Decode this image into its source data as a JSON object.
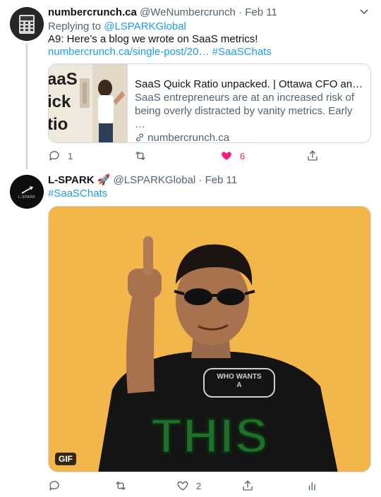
{
  "tweet1": {
    "author_name": "numbercrunch.ca",
    "handle": "@WeNumbercrunch",
    "separator": "·",
    "date": "Feb 11",
    "replying_prefix": "Replying to",
    "replying_to": "@LSPARKGlobal",
    "text_main": "A9:  Here’s a blog we wrote on SaaS metrics! ",
    "text_link": "numbercrunch.ca/single-post/20…",
    "text_hashtag": "#SaaSChats",
    "card": {
      "image_text_1": "aaS",
      "image_text_2": "ick",
      "image_text_3": "tio",
      "title": "SaaS Quick Ratio unpacked. | Ottawa CFO and Bo…",
      "description": "SaaS entrepreneurs are at an increased risk of being overly distracted by vanity metrics.  Early …",
      "domain": "numbercrunch.ca"
    },
    "actions": {
      "reply_count": "1",
      "retweet_count": "",
      "like_count": "6",
      "liked": true
    }
  },
  "tweet2": {
    "author_name": "L-SPARK",
    "author_emoji": "🚀",
    "handle": "@LSPARKGlobal",
    "separator": "·",
    "date": "Feb 11",
    "text_hashtag": "#SaaSChats",
    "gif": {
      "caption": "THIS",
      "shirt_text_1": "WHO",
      "shirt_text_2": "WANTS",
      "shirt_text_3": "A",
      "badge": "GIF",
      "avatar_text": "L-SPARK"
    },
    "actions": {
      "reply_count": "",
      "retweet_count": "",
      "like_count": "2"
    }
  },
  "colors": {
    "link": "#1d9bf0",
    "like": "#f91880",
    "secondary_text": "#536471",
    "gif_background": "#f3b64a",
    "caption_green": "#1f6e2a"
  }
}
